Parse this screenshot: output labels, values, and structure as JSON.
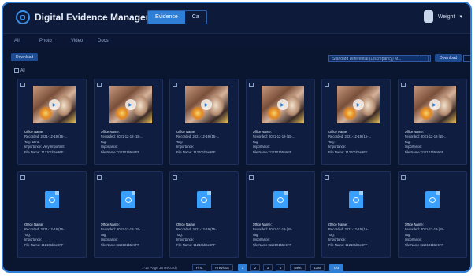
{
  "app": {
    "title": "Digital Evidence Management",
    "toggle": [
      "Evidence",
      "Ca"
    ],
    "user": "Weight"
  },
  "menu": [
    "All",
    "Photo",
    "Video",
    "Docs"
  ],
  "toolbar": {
    "left_button": "Download",
    "filter": "Standard Differential (Discrepancy) M...",
    "right_button": "Download"
  },
  "select_all": "All",
  "cards": [
    {
      "type": "image",
      "name": "Office Name:",
      "recorded": "Recorded: 2021-12-19 (15-...",
      "tag": "Tag: 1BKL",
      "importance": "Importance: Very Important",
      "file": "File Name: 112101b5e9FF"
    },
    {
      "type": "image",
      "name": "Office Name:",
      "recorded": "Recorded: 2021-12-19 (15-...",
      "tag": "Tag:",
      "importance": "Importance:",
      "file": "File Name: 112101b5e9FF"
    },
    {
      "type": "image",
      "name": "Office Name:",
      "recorded": "Recorded: 2021-12-19 (15-...",
      "tag": "Tag:",
      "importance": "Importance:",
      "file": "File Name: 112101b5e9FF"
    },
    {
      "type": "image",
      "name": "Office Name:",
      "recorded": "Recorded: 2021-12-19 (15-...",
      "tag": "Tag:",
      "importance": "Importance:",
      "file": "File Name: 112101b5e9FF"
    },
    {
      "type": "image",
      "name": "Office Name:",
      "recorded": "Recorded: 2021-12-19 (15-...",
      "tag": "Tag:",
      "importance": "Importance:",
      "file": "File Name: 112101b5e9FF"
    },
    {
      "type": "image",
      "name": "Office Name:",
      "recorded": "Recorded: 2021-12-19 (15-...",
      "tag": "Tag:",
      "importance": "Importance:",
      "file": "File Name: 112101b5e9FF"
    },
    {
      "type": "doc",
      "name": "Office Name:",
      "recorded": "Recorded: 2021-12-19 (15-...",
      "tag": "Tag:",
      "importance": "Importance:",
      "file": "File Name: 112101b5e9FF"
    },
    {
      "type": "doc",
      "name": "Office Name:",
      "recorded": "Recorded: 2021-12-19 (15-...",
      "tag": "Tag:",
      "importance": "Importance:",
      "file": "File Name: 112101b5e9FF"
    },
    {
      "type": "doc",
      "name": "Office Name:",
      "recorded": "Recorded: 2021-12-19 (15-...",
      "tag": "Tag:",
      "importance": "Importance:",
      "file": "File Name: 112101b5e9FF"
    },
    {
      "type": "doc",
      "name": "Office Name:",
      "recorded": "Recorded: 2021-12-19 (15-...",
      "tag": "Tag:",
      "importance": "Importance:",
      "file": "File Name: 112101b5e9FF"
    },
    {
      "type": "doc",
      "name": "Office Name:",
      "recorded": "Recorded: 2021-12-19 (15-...",
      "tag": "Tag:",
      "importance": "Importance:",
      "file": "File Name: 112101b5e9FF"
    },
    {
      "type": "doc",
      "name": "Office Name:",
      "recorded": "Recorded: 2021-12-19 (15-...",
      "tag": "Tag:",
      "importance": "Importance:",
      "file": "File Name: 112101b5e9FF"
    }
  ],
  "pagination": {
    "summary": "1-12 Page 36 Records",
    "first": "First",
    "previous": "Previous",
    "pages": [
      "1",
      "2",
      "3",
      "4"
    ],
    "active_page": "1",
    "next": "Next",
    "last": "Last",
    "jump": "Go"
  },
  "colors": {
    "accent": "#2f7fd6",
    "background": "#0a1530",
    "card": "#0f1d40"
  }
}
